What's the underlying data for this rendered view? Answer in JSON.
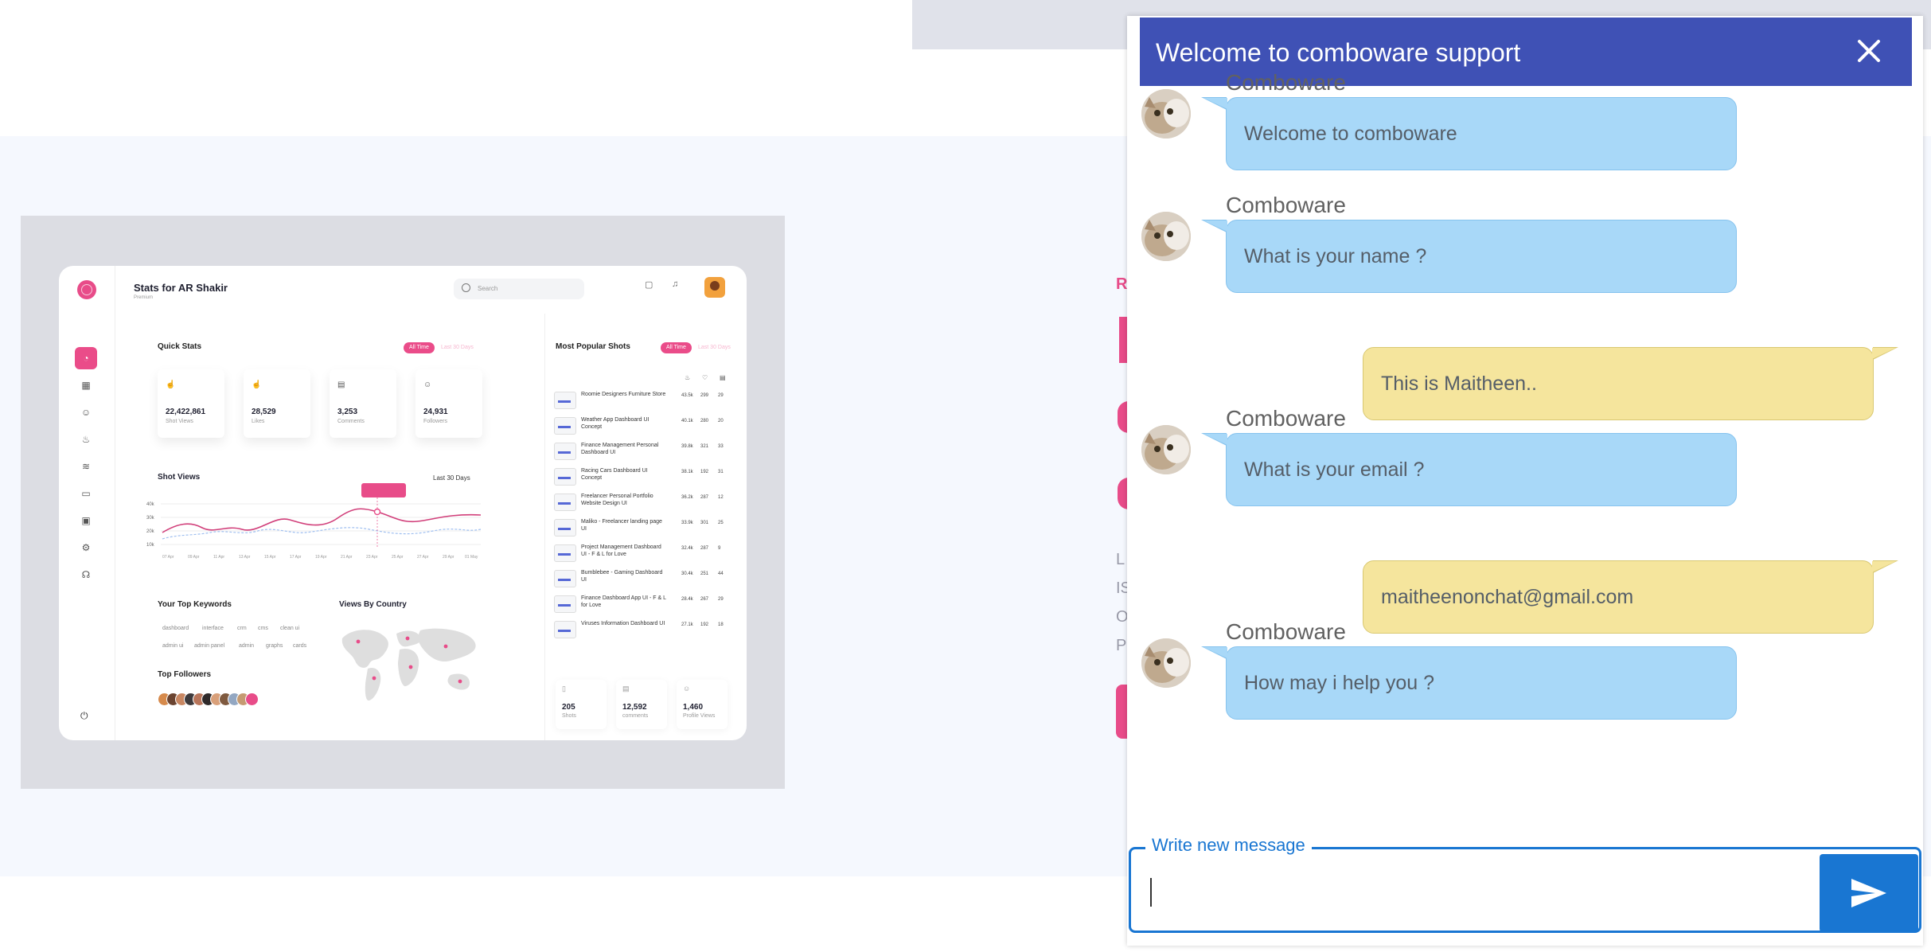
{
  "dashboard_preview": {
    "title": "Stats for AR Shakir",
    "subtitle": "Premium",
    "search_placeholder": "Search",
    "quick_stats": {
      "heading": "Quick Stats",
      "filter_on": "All Time",
      "filter_off": "Last 30 Days",
      "cards": [
        {
          "value": "22,422,861",
          "label": "Shot Views",
          "icon": "thumb-icon"
        },
        {
          "value": "28,529",
          "label": "Likes",
          "icon": "like-icon"
        },
        {
          "value": "3,253",
          "label": "Comments",
          "icon": "comment-icon"
        },
        {
          "value": "24,931",
          "label": "Followers",
          "icon": "user-icon"
        }
      ]
    },
    "shot_views": {
      "heading": "Shot Views",
      "range": "Last 30 Days",
      "y_ticks": [
        "40k",
        "30k",
        "20k",
        "10k"
      ],
      "x_ticks": [
        "07 Apr",
        "09 Apr",
        "11 Apr",
        "13 Apr",
        "15 Apr",
        "17 Apr",
        "19 Apr",
        "21 Apr",
        "23 Apr",
        "25 Apr",
        "27 Apr",
        "29 Apr",
        "01 May"
      ]
    },
    "keywords": {
      "heading": "Your Top Keywords",
      "items": [
        "dashboard",
        "interface",
        "crm",
        "cms",
        "clean ui",
        "admin ui",
        "admin panel",
        "admin",
        "graphs",
        "cards"
      ]
    },
    "views_by_country": "Views By Country",
    "top_followers": "Top Followers",
    "popular": {
      "heading": "Most Popular Shots",
      "filter_on": "All Time",
      "filter_off": "Last 30 Days",
      "rows": [
        {
          "name": "Roomie Designers Furniture Store",
          "views": "43.5k",
          "likes": "299",
          "comments": "29"
        },
        {
          "name": "Weather App Dashboard UI Concept",
          "views": "40.1k",
          "likes": "280",
          "comments": "20"
        },
        {
          "name": "Finance Management Personal Dashboard UI",
          "views": "39.8k",
          "likes": "321",
          "comments": "33"
        },
        {
          "name": "Racing Cars Dashboard UI Concept",
          "views": "38.1k",
          "likes": "192",
          "comments": "31"
        },
        {
          "name": "Freelancer Personal Portfolio Website Design UI",
          "views": "36.2k",
          "likes": "287",
          "comments": "12"
        },
        {
          "name": "Maliko - Freelancer landing page UI",
          "views": "33.9k",
          "likes": "301",
          "comments": "25"
        },
        {
          "name": "Project Management Dashboard UI - F & L for Love",
          "views": "32.4k",
          "likes": "287",
          "comments": "9"
        },
        {
          "name": "Bumblebee - Gaming Dashboard UI",
          "views": "30.4k",
          "likes": "251",
          "comments": "44"
        },
        {
          "name": "Finance Dashboard App UI - F & L for Love",
          "views": "28.4k",
          "likes": "267",
          "comments": "29"
        },
        {
          "name": "Viruses Information Dashboard UI",
          "views": "27.1k",
          "likes": "192",
          "comments": "18"
        }
      ],
      "totals": [
        {
          "value": "205",
          "label": "Shots"
        },
        {
          "value": "12,592",
          "label": "comments"
        },
        {
          "value": "1,460",
          "label": "Profile Views"
        }
      ]
    }
  },
  "background_fragments": {
    "line_r": "R",
    "line_l": "L",
    "line_is": "IS",
    "line_o": "O",
    "line_p": "P"
  },
  "chat": {
    "title": "Welcome to comboware support",
    "close_icon": "close-icon",
    "messages": [
      {
        "from": "bot",
        "sender": "Comboware",
        "text": "Welcome to comboware"
      },
      {
        "from": "bot",
        "sender": "Comboware",
        "text": "What is your name ?"
      },
      {
        "from": "user",
        "text": "This is Maitheen.."
      },
      {
        "from": "bot",
        "sender": "Comboware",
        "text": "What is your email ?"
      },
      {
        "from": "user",
        "text": "maitheenonchat@gmail.com"
      },
      {
        "from": "bot",
        "sender": "Comboware",
        "text": "How may i help you ?"
      }
    ],
    "input": {
      "legend": "Write new message",
      "value": ""
    },
    "send_icon": "send-icon",
    "colors": {
      "header": "#3f51b5",
      "bot_bubble": "#a8d8f8",
      "user_bubble": "#f5e59d",
      "accent": "#1976d2"
    }
  }
}
